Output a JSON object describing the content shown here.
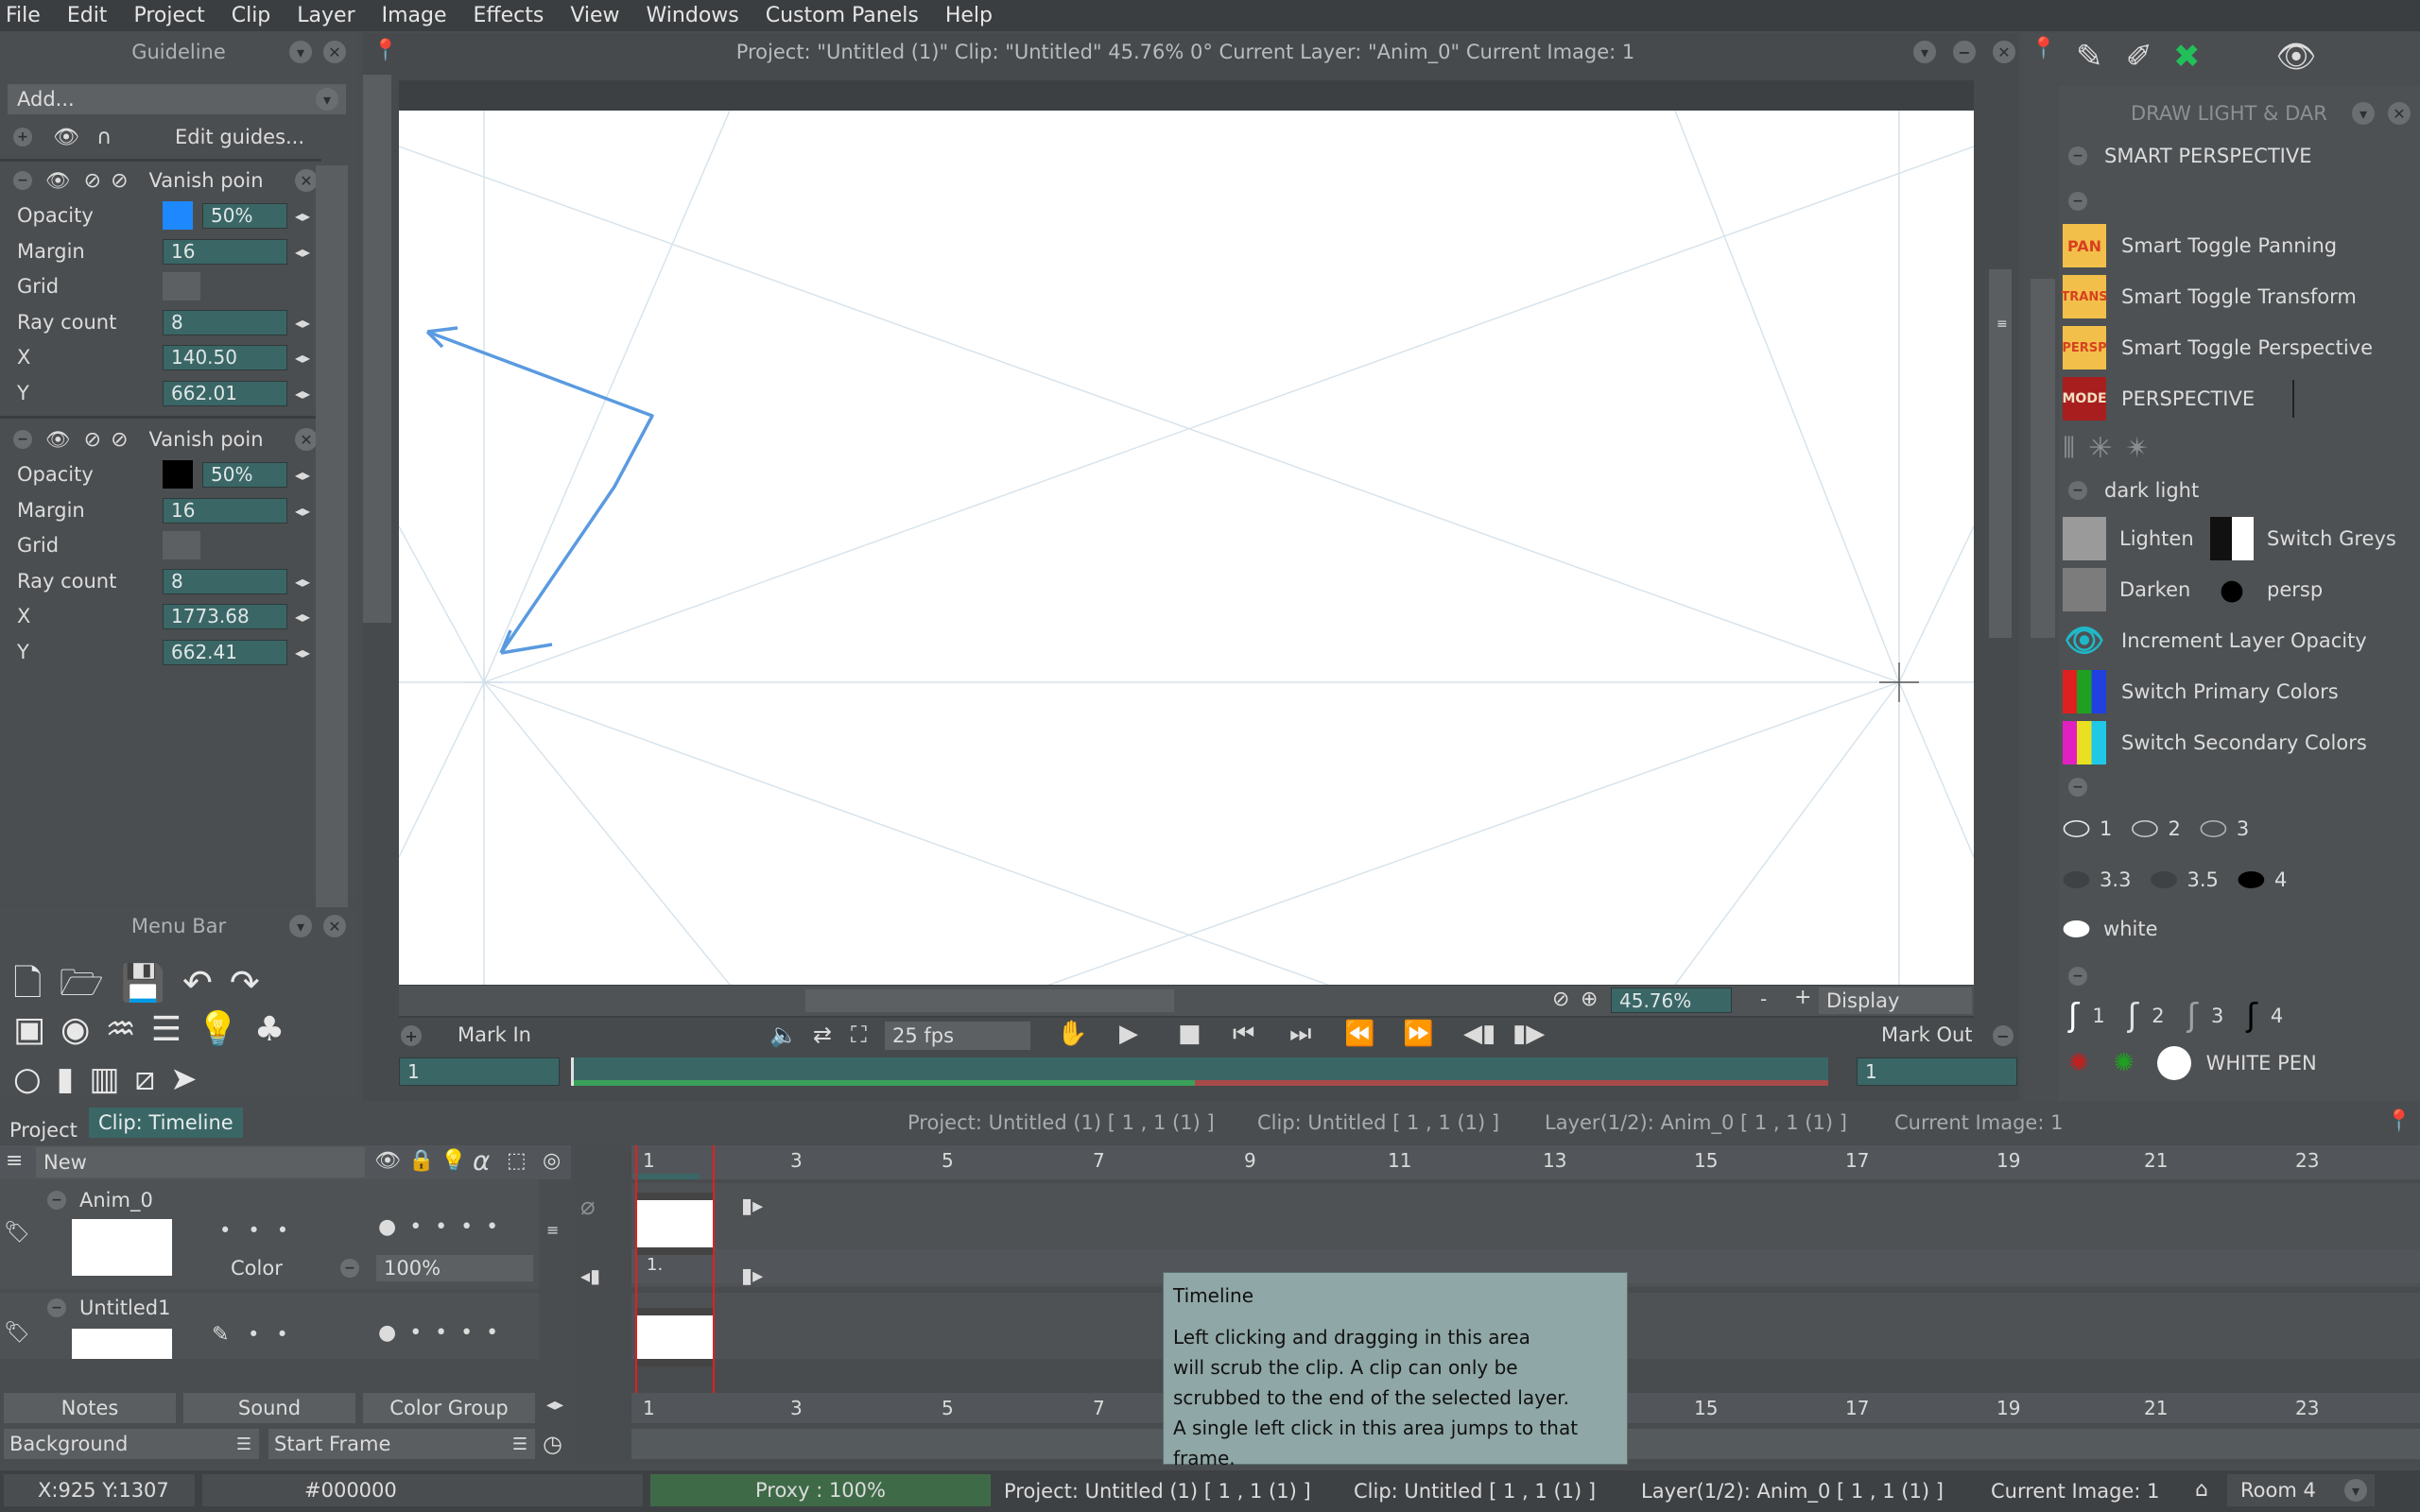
{
  "menu": [
    "File",
    "Edit",
    "Project",
    "Clip",
    "Layer",
    "Image",
    "Effects",
    "View",
    "Windows",
    "Custom Panels",
    "Help"
  ],
  "guideline": {
    "title": "Guideline",
    "add_label": "Add...",
    "edit_guides": "Edit guides...",
    "guides": [
      {
        "name": "Vanish poin",
        "opacity_label": "Opacity",
        "opacity": "50%",
        "color": "#1e88ff",
        "margin_label": "Margin",
        "margin": "16",
        "grid_label": "Grid",
        "ray_label": "Ray count",
        "ray": "8",
        "x_label": "X",
        "x": "140.50",
        "y_label": "Y",
        "y": "662.01"
      },
      {
        "name": "Vanish poin",
        "opacity_label": "Opacity",
        "opacity": "50%",
        "color": "#000000",
        "margin_label": "Margin",
        "margin": "16",
        "grid_label": "Grid",
        "ray_label": "Ray count",
        "ray": "8",
        "x_label": "X",
        "x": "1773.68",
        "y_label": "Y",
        "y": "662.41"
      }
    ]
  },
  "menu_bar_panel": {
    "title": "Menu Bar"
  },
  "canvas": {
    "title": "Project:  \"Untitled (1)\"  Clip: \"Untitled\"   45.76%   0°   Current Layer: \"Anim_0\"   Current Image: 1",
    "zoom": "45.76%",
    "display": "Display",
    "mark_in": "Mark In",
    "mark_out": "Mark Out",
    "fps": "25 fps",
    "in_value": "1",
    "out_value": "1"
  },
  "right_panel": {
    "title": "DRAW LIGHT & DAR",
    "section1": "SMART PERSPECTIVE",
    "buttons": [
      {
        "icon": "PAN",
        "label": "Smart Toggle Panning"
      },
      {
        "icon": "TRANS",
        "label": "Smart Toggle Transform"
      },
      {
        "icon": "PERSP",
        "label": "Smart Toggle Perspective"
      },
      {
        "icon": "MODE",
        "label": "PERSPECTIVE"
      }
    ],
    "section2": "dark light",
    "lighten": "Lighten",
    "switch_greys": "Switch Greys",
    "darken": "Darken",
    "persp": "persp",
    "increment": "Increment Layer Opacity",
    "switch_primary": "Switch Primary Colors",
    "switch_secondary": "Switch Secondary Colors",
    "brush_sizes": [
      "1",
      "2",
      "3",
      "3.3",
      "3.5",
      "4"
    ],
    "white": "white",
    "pen_sizes": [
      "1",
      "2",
      "3",
      "4"
    ],
    "white_pen": "WHITE PEN"
  },
  "timeline": {
    "tab_project": "Project",
    "tab_clip": "Clip: Timeline",
    "info": [
      "Project: Untitled (1) [ 1 ,  1  (1) ]",
      "Clip: Untitled [ 1 ,  1  (1) ]",
      "Layer(1/2): Anim_0 [ 1 ,  1  (1) ]",
      "Current Image: 1"
    ],
    "new_label": "New",
    "layers": [
      {
        "name": "Anim_0",
        "color_label": "Color",
        "opacity": "100%"
      },
      {
        "name": "Untitled1"
      }
    ],
    "frame_ticks": [
      "1",
      "3",
      "5",
      "7",
      "9",
      "11",
      "13",
      "15",
      "17",
      "19",
      "21",
      "23"
    ],
    "frame_label": "1.",
    "notes": "Notes",
    "sound": "Sound",
    "color_group": "Color Group",
    "background": "Background",
    "start_frame": "Start Frame"
  },
  "tooltip": {
    "title": "Timeline",
    "lines": [
      "Left clicking and dragging in this area",
      "will scrub the clip. A clip can only be",
      "scrubbed to the end of the selected layer.",
      "A single left click in this area jumps to that frame."
    ]
  },
  "status": {
    "coords": "X:925  Y:1307",
    "color": "#000000",
    "proxy": "Proxy : 100%",
    "project": "Project: Untitled (1) [ 1 ,  1  (1) ]",
    "clip": "Clip: Untitled [ 1 ,  1  (1) ]",
    "layer": "Layer(1/2): Anim_0 [ 1 ,  1  (1) ]",
    "current": "Current Image: 1",
    "room": "Room 4"
  }
}
